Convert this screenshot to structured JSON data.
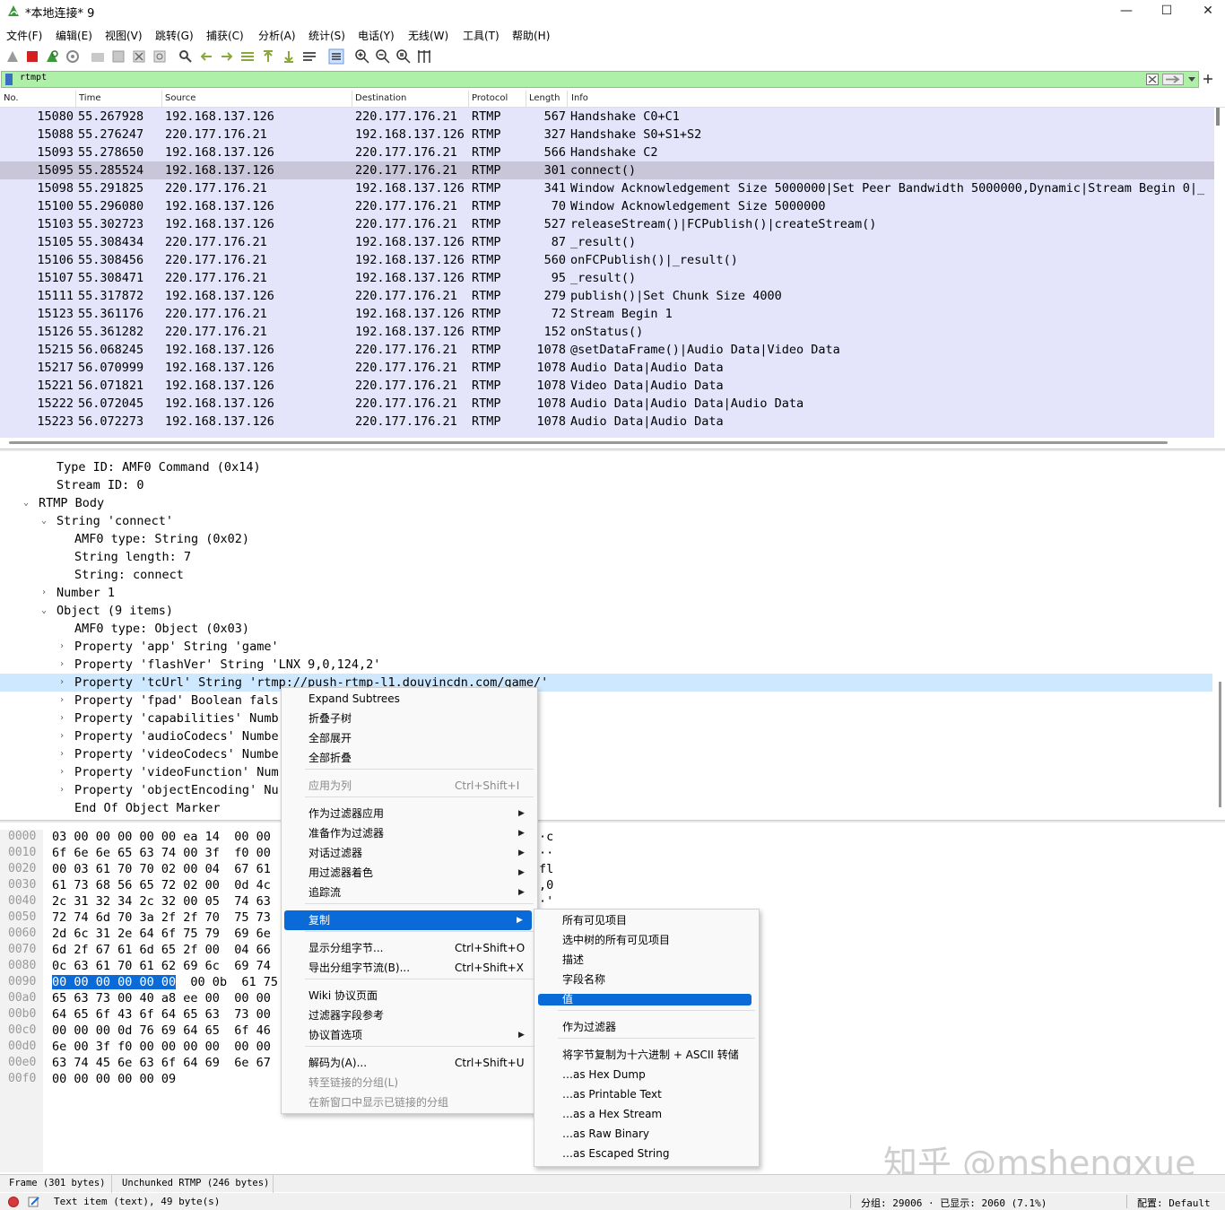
{
  "window": {
    "title": "*本地连接* 9",
    "minimize": "—",
    "maximize": "☐",
    "close": "✕"
  },
  "menubar": [
    "文件(F)",
    "编辑(E)",
    "视图(V)",
    "跳转(G)",
    "捕获(C)",
    "分析(A)",
    "统计(S)",
    "电话(Y)",
    "无线(W)",
    "工具(T)",
    "帮助(H)"
  ],
  "filter": {
    "value": "rtmpt"
  },
  "columns": [
    "No.",
    "Time",
    "Source",
    "Destination",
    "Protocol",
    "Length",
    "Info"
  ],
  "packets": [
    {
      "no": "15080",
      "time": "55.267928",
      "src": "192.168.137.126",
      "dst": "220.177.176.21",
      "proto": "RTMP",
      "len": "567",
      "info": "Handshake C0+C1"
    },
    {
      "no": "15088",
      "time": "55.276247",
      "src": "220.177.176.21",
      "dst": "192.168.137.126",
      "proto": "RTMP",
      "len": "327",
      "info": "Handshake S0+S1+S2"
    },
    {
      "no": "15093",
      "time": "55.278650",
      "src": "192.168.137.126",
      "dst": "220.177.176.21",
      "proto": "RTMP",
      "len": "566",
      "info": "Handshake C2"
    },
    {
      "no": "15095",
      "time": "55.285524",
      "src": "192.168.137.126",
      "dst": "220.177.176.21",
      "proto": "RTMP",
      "len": "301",
      "info": "connect()"
    },
    {
      "no": "15098",
      "time": "55.291825",
      "src": "220.177.176.21",
      "dst": "192.168.137.126",
      "proto": "RTMP",
      "len": "341",
      "info": "Window Acknowledgement Size 5000000|Set Peer Bandwidth 5000000,Dynamic|Stream Begin 0|_"
    },
    {
      "no": "15100",
      "time": "55.296080",
      "src": "192.168.137.126",
      "dst": "220.177.176.21",
      "proto": "RTMP",
      "len": "70",
      "info": "Window Acknowledgement Size 5000000"
    },
    {
      "no": "15103",
      "time": "55.302723",
      "src": "192.168.137.126",
      "dst": "220.177.176.21",
      "proto": "RTMP",
      "len": "527",
      "info": "releaseStream()|FCPublish()|createStream()"
    },
    {
      "no": "15105",
      "time": "55.308434",
      "src": "220.177.176.21",
      "dst": "192.168.137.126",
      "proto": "RTMP",
      "len": "87",
      "info": "_result()"
    },
    {
      "no": "15106",
      "time": "55.308456",
      "src": "220.177.176.21",
      "dst": "192.168.137.126",
      "proto": "RTMP",
      "len": "560",
      "info": "onFCPublish()|_result()"
    },
    {
      "no": "15107",
      "time": "55.308471",
      "src": "220.177.176.21",
      "dst": "192.168.137.126",
      "proto": "RTMP",
      "len": "95",
      "info": "_result()"
    },
    {
      "no": "15111",
      "time": "55.317872",
      "src": "192.168.137.126",
      "dst": "220.177.176.21",
      "proto": "RTMP",
      "len": "279",
      "info": "publish()|Set Chunk Size 4000"
    },
    {
      "no": "15123",
      "time": "55.361176",
      "src": "220.177.176.21",
      "dst": "192.168.137.126",
      "proto": "RTMP",
      "len": "72",
      "info": "Stream Begin 1"
    },
    {
      "no": "15126",
      "time": "55.361282",
      "src": "220.177.176.21",
      "dst": "192.168.137.126",
      "proto": "RTMP",
      "len": "152",
      "info": "onStatus()"
    },
    {
      "no": "15215",
      "time": "56.068245",
      "src": "192.168.137.126",
      "dst": "220.177.176.21",
      "proto": "RTMP",
      "len": "1078",
      "info": "@setDataFrame()|Audio Data|Video Data"
    },
    {
      "no": "15217",
      "time": "56.070999",
      "src": "192.168.137.126",
      "dst": "220.177.176.21",
      "proto": "RTMP",
      "len": "1078",
      "info": "Audio Data|Audio Data"
    },
    {
      "no": "15221",
      "time": "56.071821",
      "src": "192.168.137.126",
      "dst": "220.177.176.21",
      "proto": "RTMP",
      "len": "1078",
      "info": "Video Data|Audio Data"
    },
    {
      "no": "15222",
      "time": "56.072045",
      "src": "192.168.137.126",
      "dst": "220.177.176.21",
      "proto": "RTMP",
      "len": "1078",
      "info": "Audio Data|Audio Data|Audio Data"
    },
    {
      "no": "15223",
      "time": "56.072273",
      "src": "192.168.137.126",
      "dst": "220.177.176.21",
      "proto": "RTMP",
      "len": "1078",
      "info": "Audio Data|Audio Data"
    }
  ],
  "tree": [
    {
      "text": "Type ID: AMF0 Command (0x14)",
      "arrow": ""
    },
    {
      "text": "Stream ID: 0",
      "arrow": ""
    },
    {
      "text": "RTMP Body",
      "arrow": "⌄"
    },
    {
      "text": "String 'connect'",
      "arrow": "⌄"
    },
    {
      "text": "AMF0 type: String (0x02)",
      "arrow": ""
    },
    {
      "text": "String length: 7",
      "arrow": ""
    },
    {
      "text": "String: connect",
      "arrow": ""
    },
    {
      "text": "Number 1",
      "arrow": "›"
    },
    {
      "text": "Object (9 items)",
      "arrow": "⌄"
    },
    {
      "text": "AMF0 type: Object (0x03)",
      "arrow": ""
    },
    {
      "text": "Property 'app' String 'game'",
      "arrow": "›"
    },
    {
      "text": "Property 'flashVer' String 'LNX 9,0,124,2'",
      "arrow": "›"
    },
    {
      "text": "Property 'tcUrl' String 'rtmp://push-rtmp-l1.douyincdn.com/game/'",
      "arrow": "›"
    },
    {
      "text": "Property 'fpad' Boolean fals",
      "arrow": "›"
    },
    {
      "text": "Property 'capabilities' Numb",
      "arrow": "›"
    },
    {
      "text": "Property 'audioCodecs' Numbe",
      "arrow": "›"
    },
    {
      "text": "Property 'videoCodecs' Numbe",
      "arrow": "›"
    },
    {
      "text": "Property 'videoFunction' Num",
      "arrow": "›"
    },
    {
      "text": "Property 'objectEncoding' Nu",
      "arrow": "›"
    },
    {
      "text": "End Of Object Marker",
      "arrow": ""
    }
  ],
  "bytes": [
    {
      "off": "0000",
      "hex": "03 00 00 00 00 00 ea 14  00 00",
      "ascii": "·c"
    },
    {
      "off": "0010",
      "hex": "6f 6e 6e 65 63 74 00 3f  f0 00",
      "ascii": "··"
    },
    {
      "off": "0020",
      "hex": "00 03 61 70 70 02 00 04  67 61",
      "ascii": "fl"
    },
    {
      "off": "0030",
      "hex": "61 73 68 56 65 72 02 00  0d 4c",
      "ascii": ",0"
    },
    {
      "off": "0040",
      "hex": "2c 31 32 34 2c 32 00 05  74 63",
      "ascii": "·'"
    },
    {
      "off": "0050",
      "hex": "72 74 6d 70 3a 2f 2f 70  75 73",
      "ascii": ""
    },
    {
      "off": "0060",
      "hex": "2d 6c 31 2e 64 6f 75 79  69 6e",
      "ascii": ""
    },
    {
      "off": "0070",
      "hex": "6d 2f 67 61 6d 65 2f 00  04 66",
      "ascii": ""
    },
    {
      "off": "0080",
      "hex": "0c 63 61 70 61 62 69 6c  69 74",
      "ascii": ""
    },
    {
      "off": "0090",
      "hex_sel": "00 00 00 00 00 00",
      "hex": "  00 0b  61 75",
      "ascii": ""
    },
    {
      "off": "00a0",
      "hex": "65 63 73 00 40 a8 ee 00  00 00",
      "ascii": ""
    },
    {
      "off": "00b0",
      "hex": "64 65 6f 43 6f 64 65 63  73 00",
      "ascii": ""
    },
    {
      "off": "00c0",
      "hex": "00 00 00 0d 76 69 64 65  6f 46",
      "ascii": ""
    },
    {
      "off": "00d0",
      "hex": "6e 00 3f f0 00 00 00 00  00 00",
      "ascii": ""
    },
    {
      "off": "00e0",
      "hex": "63 74 45 6e 63 6f 64 69  6e 67",
      "ascii": ""
    },
    {
      "off": "00f0",
      "hex": "00 00 00 00 00 09",
      "ascii": ""
    }
  ],
  "context_menu": {
    "items": [
      {
        "label": "Expand Subtrees"
      },
      {
        "label": "折叠子树"
      },
      {
        "label": "全部展开"
      },
      {
        "label": "全部折叠"
      },
      {
        "label": "应用为列",
        "shortcut": "Ctrl+Shift+I",
        "disabled": true
      },
      {
        "label": "作为过滤器应用",
        "submenu": true
      },
      {
        "label": "准备作为过滤器",
        "submenu": true
      },
      {
        "label": "对话过滤器",
        "submenu": true
      },
      {
        "label": "用过滤器着色",
        "submenu": true
      },
      {
        "label": "追踪流",
        "submenu": true
      },
      {
        "label": "复制",
        "submenu": true
      },
      {
        "label": "显示分组字节...",
        "shortcut": "Ctrl+Shift+O"
      },
      {
        "label": "导出分组字节流(B)...",
        "shortcut": "Ctrl+Shift+X"
      },
      {
        "label": "Wiki 协议页面"
      },
      {
        "label": "过滤器字段参考"
      },
      {
        "label": "协议首选项",
        "submenu": true
      },
      {
        "label": "解码为(A)...",
        "shortcut": "Ctrl+Shift+U"
      },
      {
        "label": "转至链接的分组(L)",
        "disabled": true
      },
      {
        "label": "在新窗口中显示已链接的分组",
        "disabled": true
      }
    ]
  },
  "copy_submenu": {
    "items": [
      "所有可见项目",
      "选中树的所有可见项目",
      "描述",
      "字段名称",
      "值",
      "作为过滤器",
      "将字节复制为十六进制 + ASCII 转储",
      "…as Hex Dump",
      "…as Printable Text",
      "…as a Hex Stream",
      "…as Raw Binary",
      "…as Escaped String"
    ]
  },
  "bottom_tabs": [
    "Frame (301 bytes)",
    "Unchunked RTMP (246 bytes)"
  ],
  "status": {
    "text": "Text item (text), 49 byte(s)",
    "packets": "分组: 29006 · 已显示: 2060 (7.1%)",
    "profile": "配置: Default"
  },
  "watermark": "知乎 @mshengxue",
  "colors": {
    "filter_bg": "#aef0a8",
    "packet_row_bg": "#e4e4fb",
    "selected_row": "#c8c6d8",
    "highlight": "#0a6ad8"
  }
}
